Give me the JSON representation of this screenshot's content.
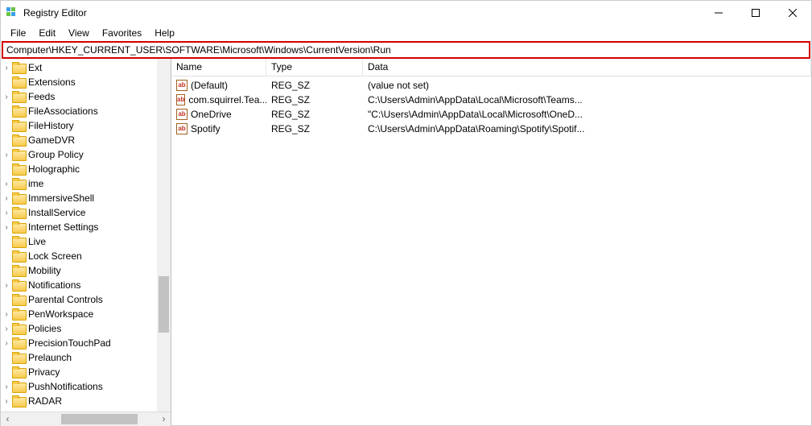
{
  "titlebar": {
    "title": "Registry Editor"
  },
  "menu": {
    "file": "File",
    "edit": "Edit",
    "view": "View",
    "favorites": "Favorites",
    "help": "Help"
  },
  "address": {
    "path": "Computer\\HKEY_CURRENT_USER\\SOFTWARE\\Microsoft\\Windows\\CurrentVersion\\Run"
  },
  "tree": {
    "items": [
      {
        "label": "Ext",
        "expander": "›"
      },
      {
        "label": "Extensions",
        "expander": ""
      },
      {
        "label": "Feeds",
        "expander": "›"
      },
      {
        "label": "FileAssociations",
        "expander": ""
      },
      {
        "label": "FileHistory",
        "expander": ""
      },
      {
        "label": "GameDVR",
        "expander": ""
      },
      {
        "label": "Group Policy",
        "expander": "›"
      },
      {
        "label": "Holographic",
        "expander": ""
      },
      {
        "label": "ime",
        "expander": "›"
      },
      {
        "label": "ImmersiveShell",
        "expander": "›"
      },
      {
        "label": "InstallService",
        "expander": "›"
      },
      {
        "label": "Internet Settings",
        "expander": "›"
      },
      {
        "label": "Live",
        "expander": ""
      },
      {
        "label": "Lock Screen",
        "expander": ""
      },
      {
        "label": "Mobility",
        "expander": ""
      },
      {
        "label": "Notifications",
        "expander": "›"
      },
      {
        "label": "Parental Controls",
        "expander": ""
      },
      {
        "label": "PenWorkspace",
        "expander": "›"
      },
      {
        "label": "Policies",
        "expander": "›"
      },
      {
        "label": "PrecisionTouchPad",
        "expander": "›"
      },
      {
        "label": "Prelaunch",
        "expander": ""
      },
      {
        "label": "Privacy",
        "expander": ""
      },
      {
        "label": "PushNotifications",
        "expander": "›"
      },
      {
        "label": "RADAR",
        "expander": "›"
      }
    ]
  },
  "list": {
    "headers": {
      "name": "Name",
      "type": "Type",
      "data": "Data"
    },
    "rows": [
      {
        "name": "(Default)",
        "type": "REG_SZ",
        "data": "(value not set)"
      },
      {
        "name": "com.squirrel.Tea...",
        "type": "REG_SZ",
        "data": "C:\\Users\\Admin\\AppData\\Local\\Microsoft\\Teams..."
      },
      {
        "name": "OneDrive",
        "type": "REG_SZ",
        "data": "\"C:\\Users\\Admin\\AppData\\Local\\Microsoft\\OneD..."
      },
      {
        "name": "Spotify",
        "type": "REG_SZ",
        "data": "C:\\Users\\Admin\\AppData\\Roaming\\Spotify\\Spotif..."
      }
    ],
    "icon_label": "ab"
  },
  "colors": {
    "highlight_border": "#d40000"
  }
}
